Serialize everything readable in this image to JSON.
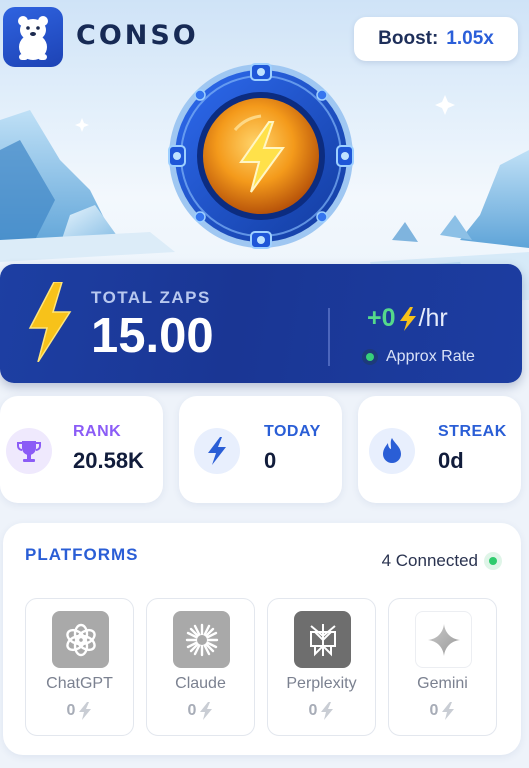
{
  "header": {
    "app_name": "CONSO",
    "boost_label": "Boost:",
    "boost_value": "1.05x"
  },
  "zaps": {
    "total_label": "TOTAL ZAPS",
    "total_value": "15.00",
    "rate_value": "+0",
    "rate_unit": "/hr",
    "approx_label": "Approx Rate"
  },
  "stats": [
    {
      "label": "RANK",
      "value": "20.58K",
      "icon": "trophy-icon",
      "color": "#8b5cf6"
    },
    {
      "label": "TODAY",
      "value": "0",
      "icon": "bolt-icon",
      "color": "#2a5ed6"
    },
    {
      "label": "STREAK",
      "value": "0d",
      "icon": "flame-icon",
      "color": "#2a5ed6"
    }
  ],
  "platforms": {
    "title": "PLATFORMS",
    "connected_label": "4 Connected",
    "items": [
      {
        "name": "ChatGPT",
        "score": "0",
        "icon": "chatgpt-icon"
      },
      {
        "name": "Claude",
        "score": "0",
        "icon": "claude-icon"
      },
      {
        "name": "Perplexity",
        "score": "0",
        "icon": "perplexity-icon"
      },
      {
        "name": "Gemini",
        "score": "0",
        "icon": "gemini-icon"
      }
    ]
  },
  "colors": {
    "accent": "#2a5ed6",
    "banner": "#1c3a9c",
    "positive": "#55d98b",
    "bolt": "#f7c21a"
  }
}
